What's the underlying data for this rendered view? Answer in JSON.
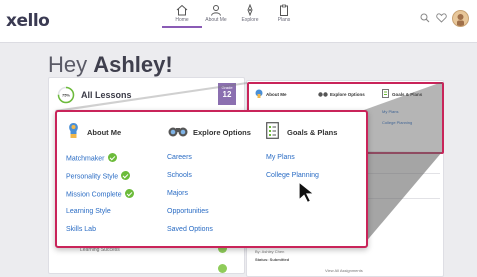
{
  "app": {
    "logo": "xello"
  },
  "nav": [
    {
      "label": "Home",
      "icon": "home-icon"
    },
    {
      "label": "About Me",
      "icon": "person-icon"
    },
    {
      "label": "Explore",
      "icon": "compass-icon"
    },
    {
      "label": "Plans",
      "icon": "clipboard-icon"
    }
  ],
  "greeting": {
    "prefix": "Hey ",
    "name": "Ashley!"
  },
  "lessons": {
    "percent_label": "75%",
    "progress": 0.75,
    "title": "All Lessons",
    "grade_label": "Grade",
    "grade": "12"
  },
  "small_menu": {
    "about": "About Me",
    "explore": "Explore Options",
    "goals": "Goals & Plans",
    "goals_links": [
      "My Plans",
      "College Planning"
    ]
  },
  "menu": {
    "about_me": {
      "title": "About Me",
      "links": [
        "Matchmaker",
        "Personality Style",
        "Mission Complete",
        "Learning Style",
        "Skills Lab"
      ],
      "completed": [
        true,
        true,
        true,
        false,
        false
      ]
    },
    "explore": {
      "title": "Explore Options",
      "links": [
        "Careers",
        "Schools",
        "Majors",
        "Opportunities",
        "Saved Options"
      ]
    },
    "goals": {
      "title": "Goals & Plans",
      "links": [
        "My Plans",
        "College Planning"
      ]
    }
  },
  "background": {
    "lesson_item": "Learning Success",
    "by_line": "By: Ashley Chen",
    "status": "Status: Submitted",
    "view_all": "View All Assignments"
  },
  "colors": {
    "accent": "#c9245a",
    "link": "#2a6cc4",
    "check": "#6cbb3a",
    "brand": "#8b6fb0"
  }
}
